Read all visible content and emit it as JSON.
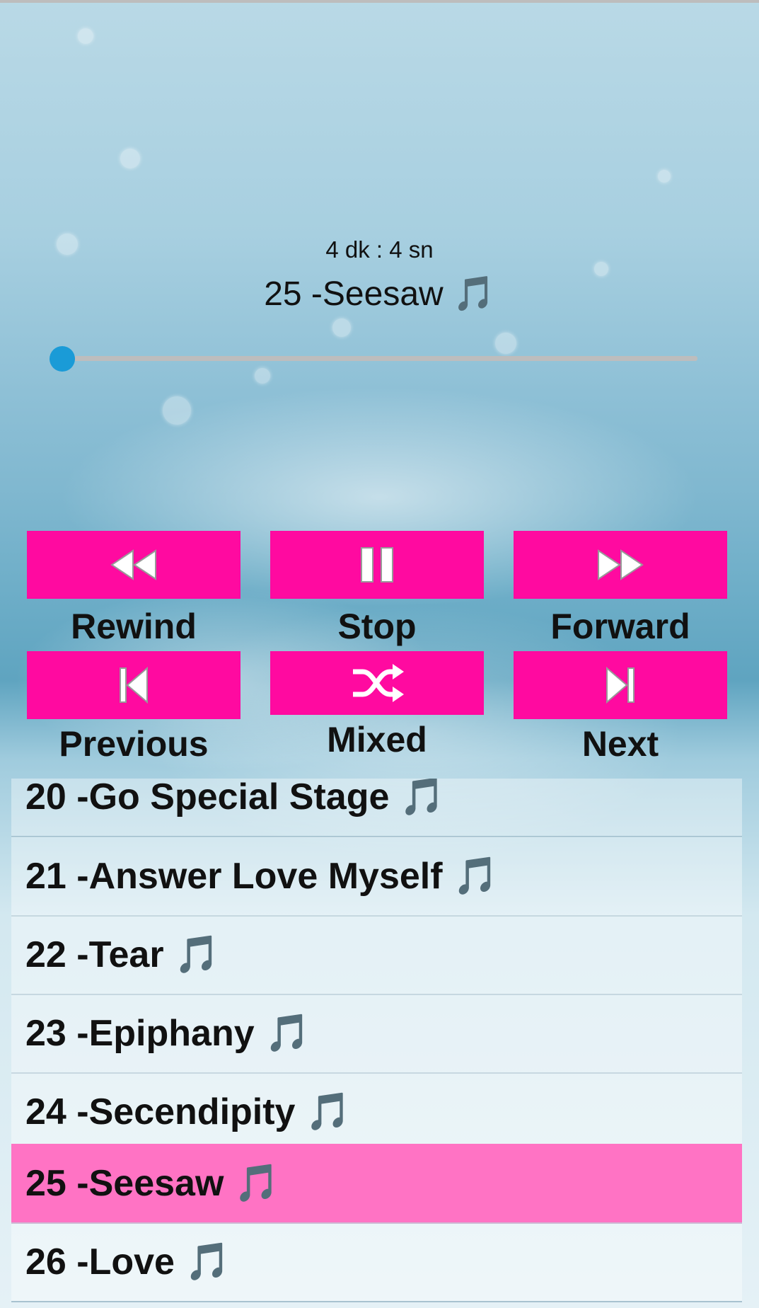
{
  "player": {
    "time": "4 dk : 4 sn",
    "now_playing": "25 -Seesaw 🎵",
    "progress": 0.02
  },
  "controls": {
    "rewind": "Rewind",
    "stop": "Stop",
    "forward": "Forward",
    "previous": "Previous",
    "mixed": "Mixed",
    "next": "Next"
  },
  "colors": {
    "button": "#ff0aa0",
    "seek": "#1a9bd7",
    "active_row": "#ff73c4"
  },
  "playlist": {
    "items": [
      {
        "label": "20 -Go Special Stage 🎵",
        "active": false
      },
      {
        "label": "21 -Answer Love Myself 🎵",
        "active": false
      },
      {
        "label": "22 -Tear 🎵",
        "active": false
      },
      {
        "label": "23 -Epiphany 🎵",
        "active": false
      },
      {
        "label": "24 -Secendipity 🎵",
        "active": false
      },
      {
        "label": "25 -Seesaw 🎵",
        "active": true
      },
      {
        "label": "26 -Love 🎵",
        "active": false
      }
    ]
  }
}
